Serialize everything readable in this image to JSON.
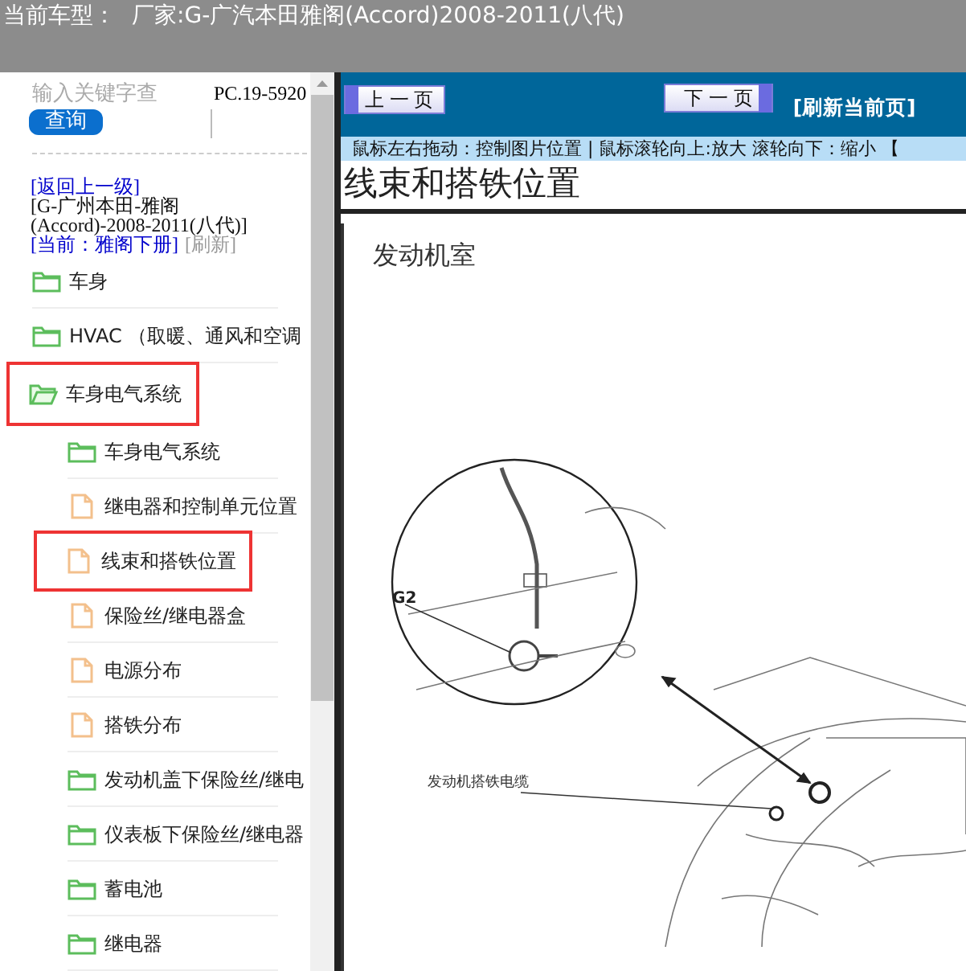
{
  "header": {
    "label": "当前车型：",
    "value": "厂家:G-广汽本田雅阁(Accord)2008-2011(八代)"
  },
  "search": {
    "placeholder": "输入关键字查",
    "button": "查询"
  },
  "part_number": "PC.19-5920",
  "breadcrumb": {
    "back": "[返回上一级]",
    "path": "[G-广州本田-雅阁(Accord)-2008-2011(八代)]",
    "current": "[当前：雅阁下册]",
    "refresh": "[刷新]"
  },
  "tree": [
    {
      "label": "车身",
      "kind": "folder",
      "expanded": false,
      "selected": false
    },
    {
      "label": "HVAC （取暖、通风和空调",
      "kind": "folder",
      "expanded": false,
      "selected": false
    },
    {
      "label": "车身电气系统",
      "kind": "folder",
      "expanded": true,
      "selected": true,
      "children": [
        {
          "label": "车身电气系统",
          "kind": "folder",
          "expanded": false,
          "selected": false
        },
        {
          "label": "继电器和控制单元位置",
          "kind": "file",
          "selected": false
        },
        {
          "label": "线束和搭铁位置",
          "kind": "file",
          "selected": true
        },
        {
          "label": "保险丝/继电器盒",
          "kind": "file",
          "selected": false
        },
        {
          "label": "电源分布",
          "kind": "file",
          "selected": false
        },
        {
          "label": "搭铁分布",
          "kind": "file",
          "selected": false
        },
        {
          "label": "发动机盖下保险丝/继电",
          "kind": "folder",
          "expanded": false,
          "selected": false
        },
        {
          "label": "仪表板下保险丝/继电器",
          "kind": "folder",
          "expanded": false,
          "selected": false
        },
        {
          "label": "蓄电池",
          "kind": "folder",
          "expanded": false,
          "selected": false
        },
        {
          "label": "继电器",
          "kind": "folder",
          "expanded": false,
          "selected": false
        }
      ]
    }
  ],
  "nav": {
    "prev": "上 一 页",
    "next": "下 一 页",
    "refresh": "[刷新当前页]"
  },
  "hint": "鼠标左右拖动：控制图片位置 | 鼠标滚轮向上:放大   滚轮向下：缩小 【",
  "page": {
    "title": "线束和搭铁位置",
    "section": "发动机室",
    "callouts": [
      "G2",
      "发动机搭铁电缆"
    ]
  }
}
